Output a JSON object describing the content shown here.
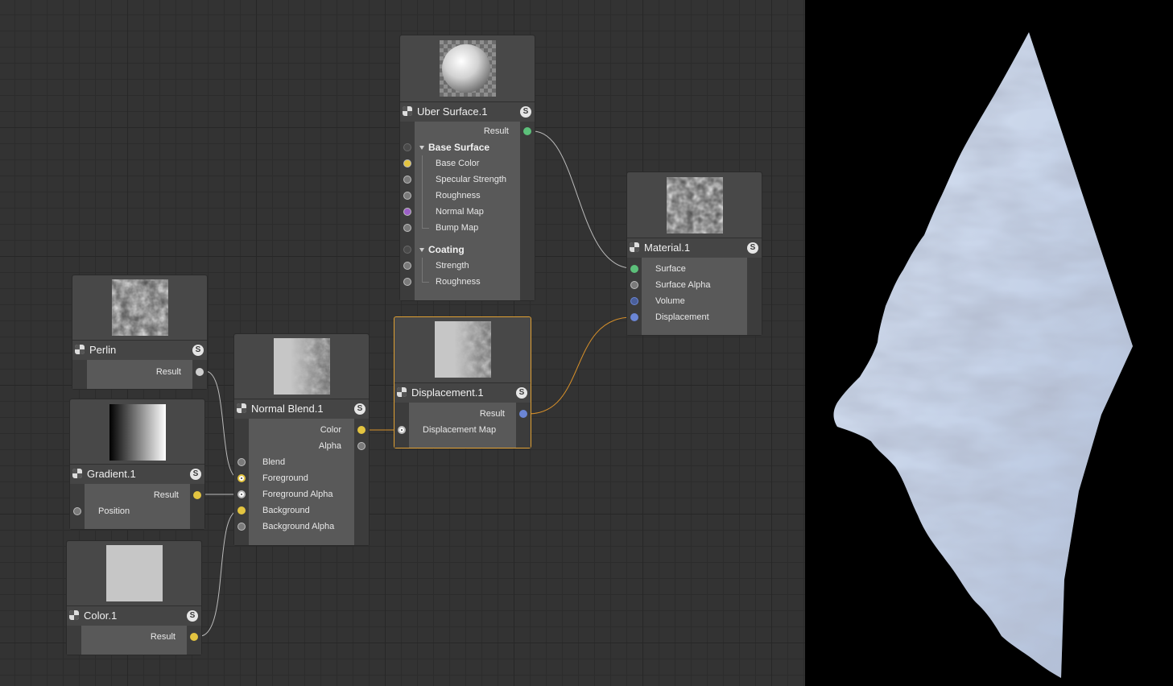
{
  "graph": {
    "nodes": {
      "uber": {
        "title": "Uber Surface.1",
        "badge": "S",
        "thumb_icon": "sphere-preview-icon",
        "result_label": "Result",
        "base_group": "Base Surface",
        "base_items": [
          "Base Color",
          "Specular Strength",
          "Roughness",
          "Normal Map",
          "Bump Map"
        ],
        "coating_group": "Coating",
        "coating_items": [
          "Strength",
          "Roughness"
        ]
      },
      "material": {
        "title": "Material.1",
        "badge": "S",
        "thumb_icon": "material-preview-icon",
        "inputs": [
          "Surface",
          "Surface Alpha",
          "Volume",
          "Displacement"
        ]
      },
      "perlin": {
        "title": "Perlin",
        "badge": "S",
        "thumb_icon": "noise-preview-icon",
        "result_label": "Result"
      },
      "gradient": {
        "title": "Gradient.1",
        "badge": "S",
        "thumb_icon": "gradient-preview-icon",
        "result_label": "Result",
        "input_label": "Position"
      },
      "color": {
        "title": "Color.1",
        "badge": "S",
        "thumb_icon": "color-swatch-icon",
        "result_label": "Result"
      },
      "normal_blend": {
        "title": "Normal Blend.1",
        "badge": "S",
        "thumb_icon": "blend-preview-icon",
        "outputs": [
          "Color",
          "Alpha"
        ],
        "inputs": [
          "Blend",
          "Foreground",
          "Foreground Alpha",
          "Background",
          "Background Alpha"
        ]
      },
      "displacement": {
        "title": "Displacement.1",
        "badge": "S",
        "thumb_icon": "displacement-preview-icon",
        "result_label": "Result",
        "input_label": "Displacement Map",
        "selected": true
      }
    }
  },
  "colors": {
    "surface_port": "#5cc07a",
    "color_port": "#e3c440",
    "vector_port": "#6b86d6",
    "normal_port": "#9b5fc7",
    "grey_port": "#cfcfcf",
    "selection": "#e0a033",
    "wire": "#bbbbbb",
    "wire_selected": "#d7902a",
    "mesh": "#c9d6ea"
  }
}
